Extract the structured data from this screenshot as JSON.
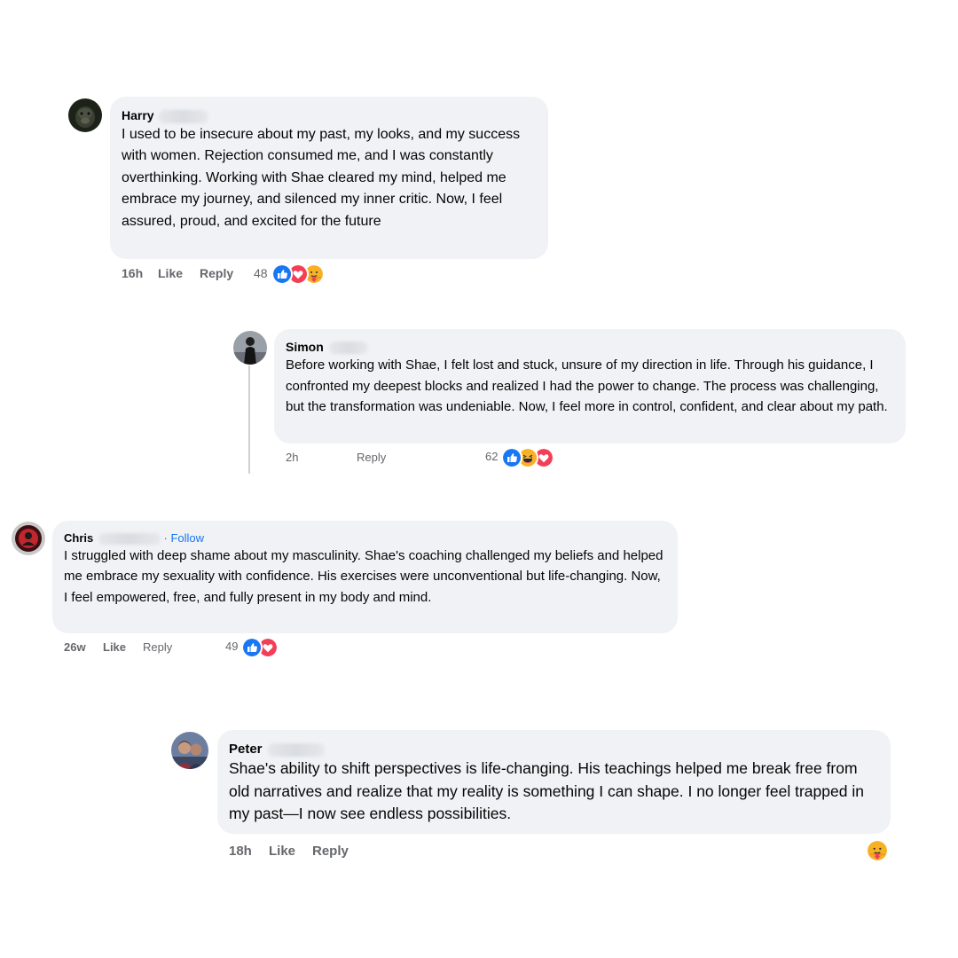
{
  "comments": [
    {
      "name": "Harry",
      "text": "I used to be insecure about my past, my looks, and my success with women. Rejection consumed me, and I was constantly overthinking. Working with Shae cleared my mind, helped me embrace my journey, and silenced my inner critic. Now, I feel assured, proud, and excited for the future",
      "time": "16h",
      "like": "Like",
      "reply": "Reply",
      "reaction_count": "48",
      "reactions": [
        "like-icon",
        "love-icon",
        "care-icon"
      ]
    },
    {
      "name": "Simon",
      "text": "Before working with Shae, I felt lost and stuck, unsure of my direction in life. Through his guidance, I confronted my deepest blocks and realized I had the power to change. The process was challenging, but the transformation was undeniable. Now, I feel more in control, confident, and clear about my path.",
      "time": "2h",
      "reply": "Reply",
      "reaction_count": "62",
      "reactions": [
        "like-icon",
        "haha-icon",
        "love-icon"
      ]
    },
    {
      "name": "Chris",
      "follow_sep": "· ",
      "follow": "Follow",
      "text": "I struggled with deep shame about my masculinity. Shae's coaching challenged my beliefs and helped me embrace my sexuality with confidence. His exercises were unconventional but life-changing. Now, I feel empowered, free, and fully present in my body and mind.",
      "time": "26w",
      "like": "Like",
      "reply": "Reply",
      "reaction_count": "49",
      "reactions": [
        "like-icon",
        "love-icon"
      ]
    },
    {
      "name": "Peter",
      "text": "Shae's ability to shift perspectives is life-changing. His teachings helped me break free from old narratives and realize that my reality is something I can shape. I no longer feel trapped in my past—I now see endless possibilities.",
      "time": "18h",
      "like": "Like",
      "reply": "Reply",
      "reactions": [
        "care-icon"
      ]
    }
  ],
  "colors": {
    "bubble": "#f0f2f5",
    "meta": "#65676b",
    "like": "#1877f2",
    "love": "#f33e58",
    "haha": "#f7b125"
  }
}
